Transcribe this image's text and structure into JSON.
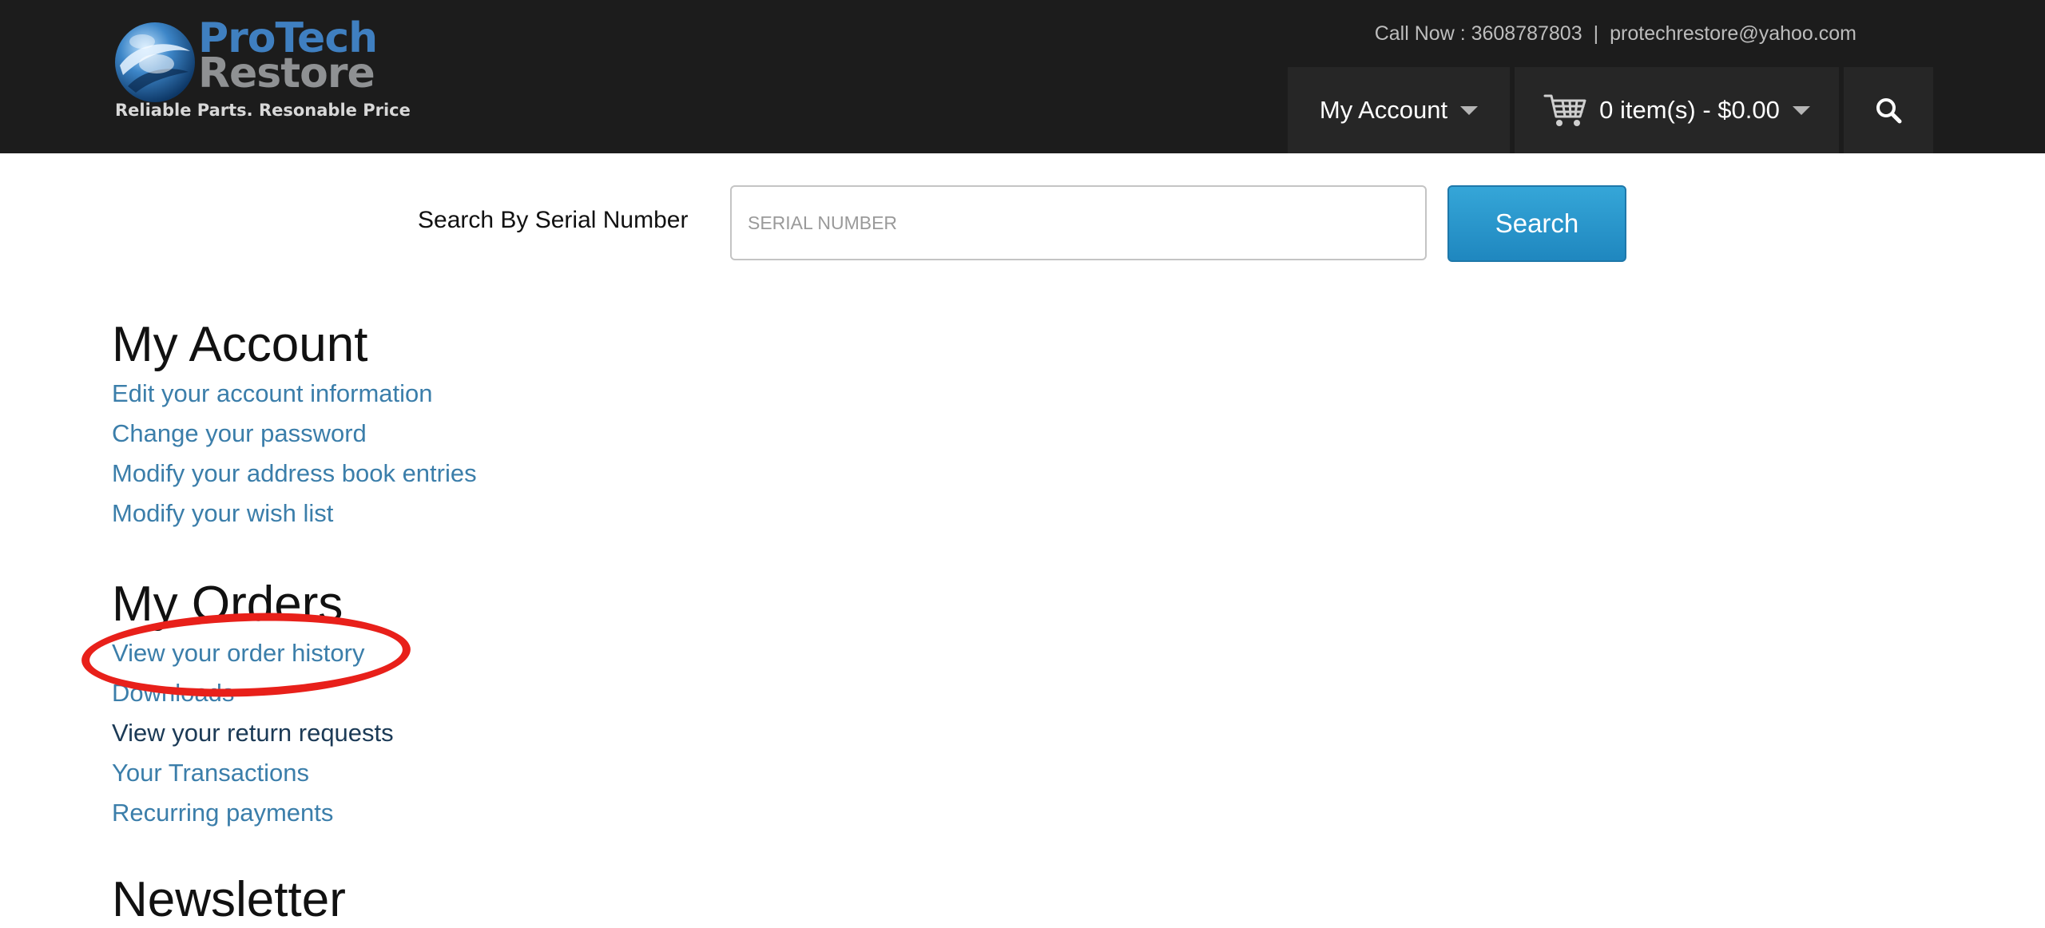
{
  "header": {
    "logo": {
      "line1": "ProTech",
      "line2": "Restore",
      "tagline": "Reliable Parts.  Resonable Price"
    },
    "contact": {
      "phone": "Call Now : 3608787803",
      "separator": "|",
      "email": "protechrestore@yahoo.com"
    },
    "account_label": "My Account",
    "cart_label": "0 item(s) - $0.00",
    "search_icon": "search-icon"
  },
  "serial_search": {
    "label": "Search By Serial Number",
    "placeholder": "SERIAL NUMBER",
    "button": "Search"
  },
  "sections": {
    "account": {
      "title": "My Account",
      "links": [
        "Edit your account information",
        "Change your password",
        "Modify your address book entries",
        "Modify your wish list"
      ]
    },
    "orders": {
      "title": "My Orders",
      "links": [
        "View your order history",
        "Downloads",
        "View your return requests",
        "Your Transactions",
        "Recurring payments"
      ]
    },
    "newsletter": {
      "title": "Newsletter"
    }
  },
  "colors": {
    "header_bg": "#1c1c1c",
    "link": "#3b7eaa",
    "visited_link": "#1b3a56",
    "search_button": "#2596cc",
    "highlight_ring": "#e8201a"
  }
}
